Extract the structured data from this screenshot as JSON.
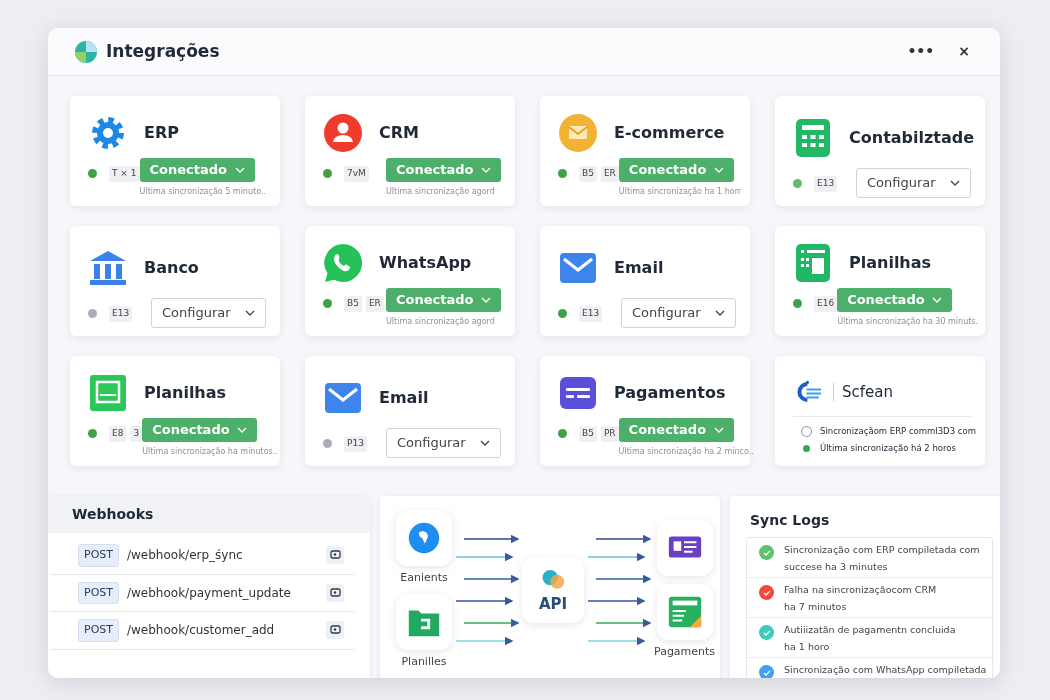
{
  "window": {
    "title": "Integrações",
    "menu_label": "•••",
    "close_label": "×"
  },
  "cards": [
    {
      "name": "ERP",
      "color": "#43a047",
      "tags": [
        "T × 1"
      ],
      "action": {
        "kind": "connected",
        "label": "Conectado"
      },
      "sync": "Ultima sincronização 5 minuto.."
    },
    {
      "name": "CRM",
      "color": "#43a047",
      "tags": [
        "7vM"
      ],
      "action": {
        "kind": "connected",
        "label": "Conectado"
      },
      "sync": "Ultima sincronização agord"
    },
    {
      "name": "E-commerce",
      "color": "#43a047",
      "tags": [
        "B5",
        "ER"
      ],
      "action": {
        "kind": "connected",
        "label": "Conectado"
      },
      "sync": "Última sincronização ha 1 horr"
    },
    {
      "name": "Contabilztade",
      "color": "#66bb6a",
      "tags": [
        "E13"
      ],
      "action": {
        "kind": "configure",
        "label": "Configurar"
      }
    },
    {
      "name": "Banco",
      "color": "#a9adb8",
      "tags": [
        "E13"
      ],
      "action": {
        "kind": "configure",
        "label": "Configurar"
      }
    },
    {
      "name": "WhatsApp",
      "color": "#43a047",
      "tags": [
        "B5",
        "ER"
      ],
      "action": {
        "kind": "connected",
        "label": "Conectado"
      },
      "sync": "Ultima sincronização agord"
    },
    {
      "name": "Email",
      "color": "#43a047",
      "tags": [
        "E13"
      ],
      "action": {
        "kind": "configure",
        "label": "Configurar"
      }
    },
    {
      "name": "Planilhas",
      "color": "#43a047",
      "tags": [
        "E16"
      ],
      "action": {
        "kind": "connected",
        "label": "Conectado"
      },
      "sync": "Última sincronização ha 30 minuts."
    },
    {
      "name": "Planilhas",
      "color": "#43a047",
      "tags": [
        "E8",
        "3"
      ],
      "action": {
        "kind": "connected",
        "label": "Conectado"
      },
      "sync": "Última sincronização ha minutos.."
    },
    {
      "name": "Email",
      "color": "#a9adb8",
      "tags": [
        "P13"
      ],
      "action": {
        "kind": "configure",
        "label": "Configurar"
      }
    },
    {
      "name": "Pagamentos",
      "color": "#43a047",
      "tags": [
        "B5",
        "PR"
      ],
      "action": {
        "kind": "connected",
        "label": "Conectado"
      },
      "sync": "Última sincronização ha 2 minco.."
    }
  ],
  "status_card": {
    "title": "Scfean",
    "items": [
      {
        "text": "Sincronizaçãom ERP comml3D3 com",
        "selected": false
      },
      {
        "text": "Última sincronização há 2 horos",
        "selected": true
      }
    ]
  },
  "webhooks": {
    "title": "Webhooks",
    "rows": [
      {
        "method": "POST",
        "path": "/webhook/erp_śync"
      },
      {
        "method": "POST",
        "path": "/webhook/payment_update"
      },
      {
        "method": "POST",
        "path": "/webhook/customer_add"
      }
    ]
  },
  "diagram": {
    "hub": "API",
    "left_labels": [
      "Eanients",
      "Planilles"
    ],
    "right_label": "Pagaments"
  },
  "sync_logs": {
    "title": "Sync Logs",
    "entries": [
      {
        "lines": [
          "Sincronização com ERP compiletada com",
          "succese ha 3 minutes"
        ],
        "color": "#5cc26b"
      },
      {
        "lines": [
          "Falha na sincronizaçãocom CRM",
          "ha 7 minutos"
        ],
        "color": "#f2483a"
      },
      {
        "lines": [
          "Autiiizatãn de pagamentn concluida",
          "ha 1 horo"
        ],
        "color": "#3ecbbb"
      },
      {
        "lines": [
          "Sincronização com WhatsApp compiletada"
        ],
        "color": "#42a0f0"
      }
    ]
  }
}
